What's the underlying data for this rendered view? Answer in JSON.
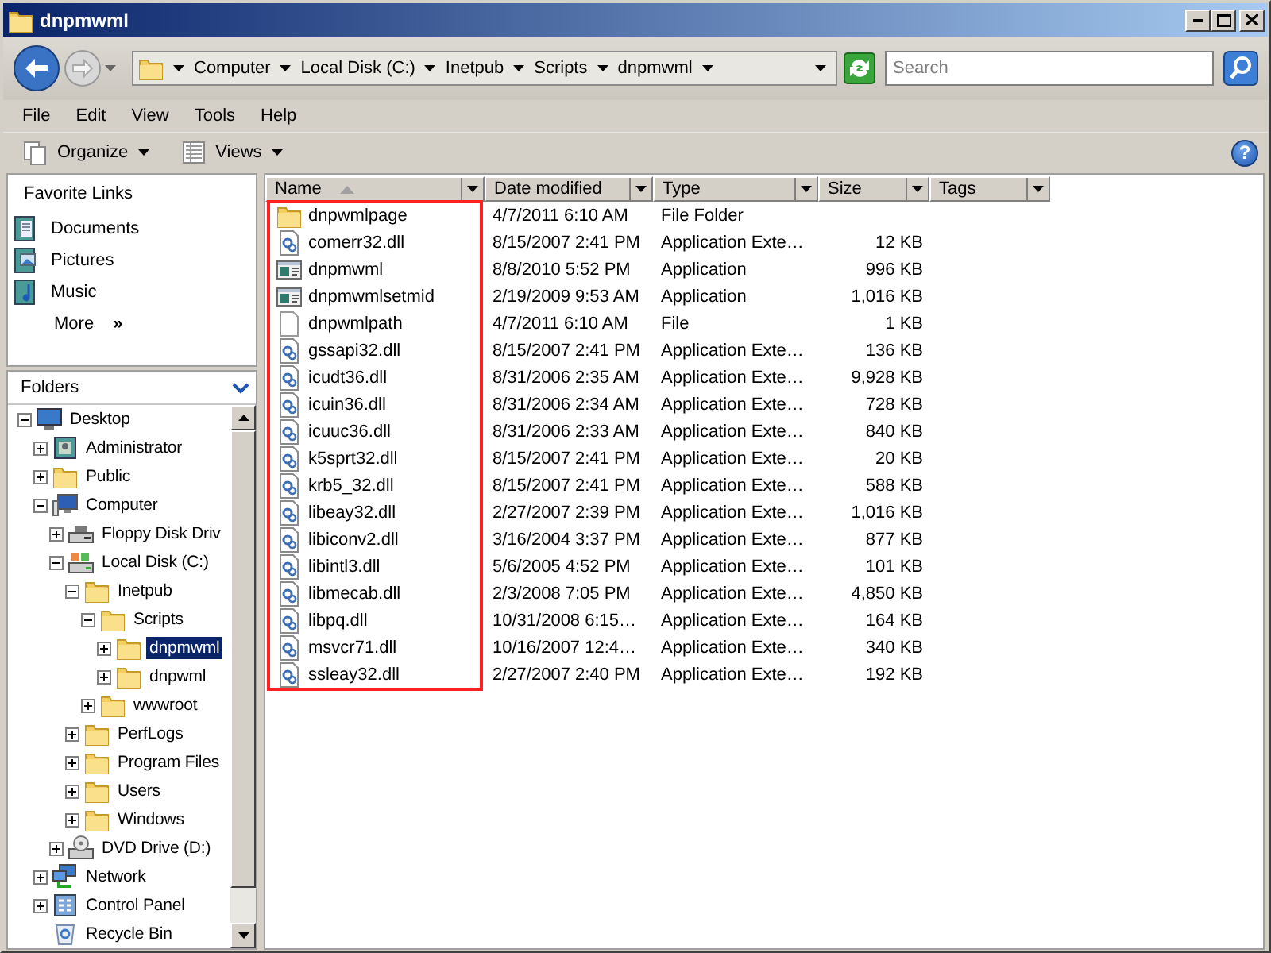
{
  "window": {
    "title": "dnpmwml"
  },
  "address_bar": {
    "crumbs": [
      "Computer",
      "Local Disk (C:)",
      "Inetpub",
      "Scripts",
      "dnpmwml"
    ]
  },
  "search": {
    "placeholder": "Search"
  },
  "menu": [
    "File",
    "Edit",
    "View",
    "Tools",
    "Help"
  ],
  "toolbar": {
    "buttons": [
      {
        "label": "Organize",
        "kind": "organize"
      },
      {
        "label": "Views",
        "kind": "views"
      }
    ],
    "help": "?"
  },
  "favorite_links": {
    "title": "Favorite Links",
    "items": [
      {
        "label": "Documents",
        "kind": "documents"
      },
      {
        "label": "Pictures",
        "kind": "pictures"
      },
      {
        "label": "Music",
        "kind": "music"
      }
    ],
    "more": {
      "label": "More",
      "chevron": "»"
    }
  },
  "folders": {
    "title": "Folders",
    "items": [
      {
        "label": "Desktop",
        "kind": "desktop",
        "expanded": true,
        "selected": false,
        "children": [
          {
            "label": "Administrator",
            "kind": "user",
            "expanded": false,
            "selected": false
          },
          {
            "label": "Public",
            "kind": "folder",
            "expanded": false,
            "selected": false
          },
          {
            "label": "Computer",
            "kind": "computer",
            "expanded": true,
            "selected": false,
            "children": [
              {
                "label": "Floppy Disk Driv",
                "kind": "floppy",
                "expanded": false,
                "selected": false
              },
              {
                "label": "Local Disk (C:)",
                "kind": "disk",
                "expanded": true,
                "selected": false,
                "children": [
                  {
                    "label": "Inetpub",
                    "kind": "folder",
                    "expanded": true,
                    "selected": false,
                    "children": [
                      {
                        "label": "Scripts",
                        "kind": "folder",
                        "expanded": true,
                        "selected": false,
                        "children": [
                          {
                            "label": "dnpmwml",
                            "kind": "folder",
                            "expanded": false,
                            "selected": true
                          },
                          {
                            "label": "dnpwml",
                            "kind": "folder",
                            "expanded": false,
                            "selected": false
                          }
                        ]
                      },
                      {
                        "label": "wwwroot",
                        "kind": "folder",
                        "expanded": false,
                        "selected": false
                      }
                    ]
                  },
                  {
                    "label": "PerfLogs",
                    "kind": "folder",
                    "expanded": false,
                    "selected": false
                  },
                  {
                    "label": "Program Files",
                    "kind": "folder",
                    "expanded": false,
                    "selected": false
                  },
                  {
                    "label": "Users",
                    "kind": "folder",
                    "expanded": false,
                    "selected": false
                  },
                  {
                    "label": "Windows",
                    "kind": "folder",
                    "expanded": false,
                    "selected": false
                  }
                ]
              },
              {
                "label": "DVD Drive (D:)",
                "kind": "dvd",
                "expanded": false,
                "selected": false
              }
            ]
          },
          {
            "label": "Network",
            "kind": "network",
            "expanded": false,
            "selected": false
          },
          {
            "label": "Control Panel",
            "kind": "control",
            "expanded": false,
            "selected": false
          },
          {
            "label": "Recycle Bin",
            "kind": "recycle",
            "leaf": true,
            "selected": false
          }
        ]
      }
    ]
  },
  "file_list": {
    "name_column_highlighted": true,
    "columns": [
      {
        "label": "Name",
        "sorted": true
      },
      {
        "label": "Date modified",
        "sorted": false
      },
      {
        "label": "Type",
        "sorted": false
      },
      {
        "label": "Size",
        "sorted": false
      },
      {
        "label": "Tags",
        "sorted": false
      }
    ],
    "rows": [
      {
        "name": "dnpwmlpage",
        "date": "4/7/2011 6:10 AM",
        "type": "File Folder",
        "kind": "folder"
      },
      {
        "name": "comerr32.dll",
        "date": "8/15/2007 2:41 PM",
        "type": "Application Exte…",
        "size": "12 KB",
        "kind": "dll"
      },
      {
        "name": "dnpmwml",
        "date": "8/8/2010 5:52 PM",
        "type": "Application",
        "size": "996 KB",
        "kind": "app"
      },
      {
        "name": "dnpmwmlsetmid",
        "date": "2/19/2009 9:53 AM",
        "type": "Application",
        "size": "1,016 KB",
        "kind": "app"
      },
      {
        "name": "dnpwmlpath",
        "date": "4/7/2011 6:10 AM",
        "type": "File",
        "size": "1 KB",
        "kind": "file"
      },
      {
        "name": "gssapi32.dll",
        "date": "8/15/2007 2:41 PM",
        "type": "Application Exte…",
        "size": "136 KB",
        "kind": "dll"
      },
      {
        "name": "icudt36.dll",
        "date": "8/31/2006 2:35 AM",
        "type": "Application Exte…",
        "size": "9,928 KB",
        "kind": "dll"
      },
      {
        "name": "icuin36.dll",
        "date": "8/31/2006 2:34 AM",
        "type": "Application Exte…",
        "size": "728 KB",
        "kind": "dll"
      },
      {
        "name": "icuuc36.dll",
        "date": "8/31/2006 2:33 AM",
        "type": "Application Exte…",
        "size": "840 KB",
        "kind": "dll"
      },
      {
        "name": "k5sprt32.dll",
        "date": "8/15/2007 2:41 PM",
        "type": "Application Exte…",
        "size": "20 KB",
        "kind": "dll"
      },
      {
        "name": "krb5_32.dll",
        "date": "8/15/2007 2:41 PM",
        "type": "Application Exte…",
        "size": "588 KB",
        "kind": "dll"
      },
      {
        "name": "libeay32.dll",
        "date": "2/27/2007 2:39 PM",
        "type": "Application Exte…",
        "size": "1,016 KB",
        "kind": "dll"
      },
      {
        "name": "libiconv2.dll",
        "date": "3/16/2004 3:37 PM",
        "type": "Application Exte…",
        "size": "877 KB",
        "kind": "dll"
      },
      {
        "name": "libintl3.dll",
        "date": "5/6/2005 4:52 PM",
        "type": "Application Exte…",
        "size": "101 KB",
        "kind": "dll"
      },
      {
        "name": "libmecab.dll",
        "date": "2/3/2008 7:05 PM",
        "type": "Application Exte…",
        "size": "4,850 KB",
        "kind": "dll"
      },
      {
        "name": "libpq.dll",
        "date": "10/31/2008 6:15…",
        "type": "Application Exte…",
        "size": "164 KB",
        "kind": "dll"
      },
      {
        "name": "msvcr71.dll",
        "date": "10/16/2007 12:4…",
        "type": "Application Exte…",
        "size": "340 KB",
        "kind": "dll"
      },
      {
        "name": "ssleay32.dll",
        "date": "2/27/2007 2:40 PM",
        "type": "Application Exte…",
        "size": "192 KB",
        "kind": "dll"
      }
    ]
  }
}
